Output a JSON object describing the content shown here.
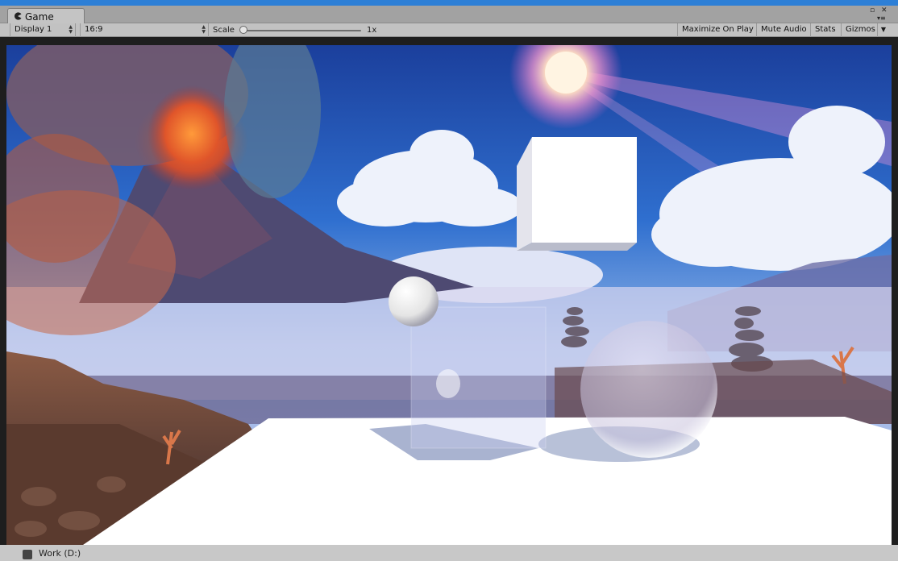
{
  "window": {
    "tab_label": "Game",
    "tab_icon": "pacman-game-icon",
    "window_buttons": {
      "maximize": "▫",
      "close": "✕",
      "menu": "▾≡"
    }
  },
  "toolbar": {
    "display": "Display 1",
    "aspect": "16:9",
    "scale_label": "Scale",
    "scale_value": "1x",
    "scale_level": 0.0,
    "maximize_on_play": "Maximize On Play",
    "mute_audio": "Mute Audio",
    "stats": "Stats",
    "gizmos": "Gizmos"
  },
  "taskbar": {
    "drive_label": "Work (D:)"
  },
  "colors": {
    "accent": "#2d7fd6",
    "tab_bg": "#c4c4c4",
    "toolbar_bg": "#c2c2c2",
    "floor": "#ffffff",
    "sky_top": "#1e4fb0"
  }
}
